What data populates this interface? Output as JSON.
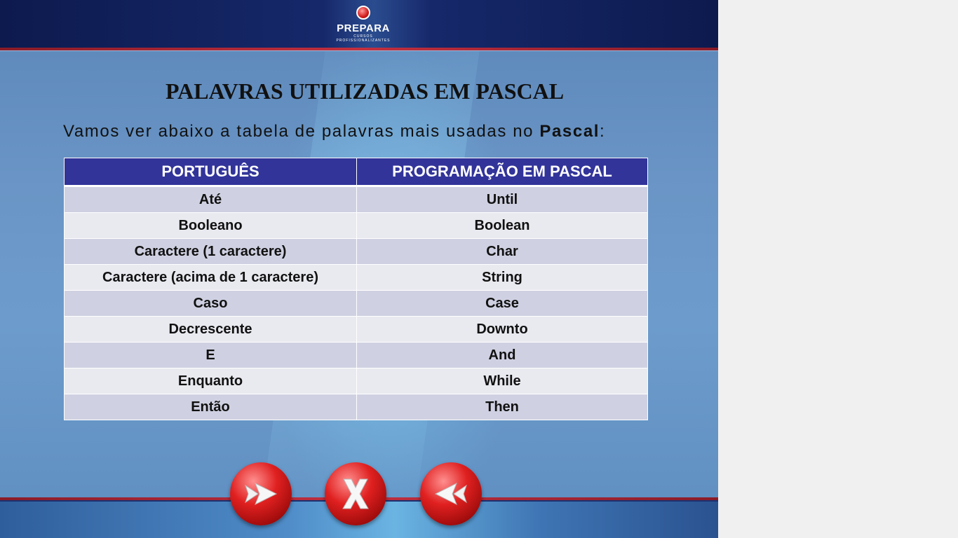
{
  "header": {
    "logo_text": "PREPARA",
    "logo_sub": "CURSOS PROFISSIONALIZANTES"
  },
  "title": "PALAVRAS UTILIZADAS EM PASCAL",
  "subtitle": {
    "text_before": "Vamos ver abaixo a tabela de palavras mais usadas no ",
    "emphasis": "Pascal",
    "text_after": ":"
  },
  "table": {
    "headers": [
      "PORTUGUÊS",
      "PROGRAMAÇÃO EM PASCAL"
    ],
    "rows": [
      [
        "Até",
        "Until"
      ],
      [
        "Booleano",
        "Boolean"
      ],
      [
        "Caractere (1 caractere)",
        "Char"
      ],
      [
        "Caractere (acima de 1 caractere)",
        "String"
      ],
      [
        "Caso",
        "Case"
      ],
      [
        "Decrescente",
        "Downto"
      ],
      [
        "E",
        "And"
      ],
      [
        "Enquanto",
        "While"
      ],
      [
        "Então",
        "Then"
      ]
    ]
  },
  "nav": {
    "next_icon": "double-arrow-right-icon",
    "close_icon": "close-x-icon",
    "prev_icon": "double-arrow-left-icon"
  },
  "colors": {
    "table_header": "#32349a",
    "row_odd": "#cfd1e2",
    "row_even": "#e9eaf0",
    "accent_red": "#c23040",
    "header_navy": "#0d1a4e"
  }
}
